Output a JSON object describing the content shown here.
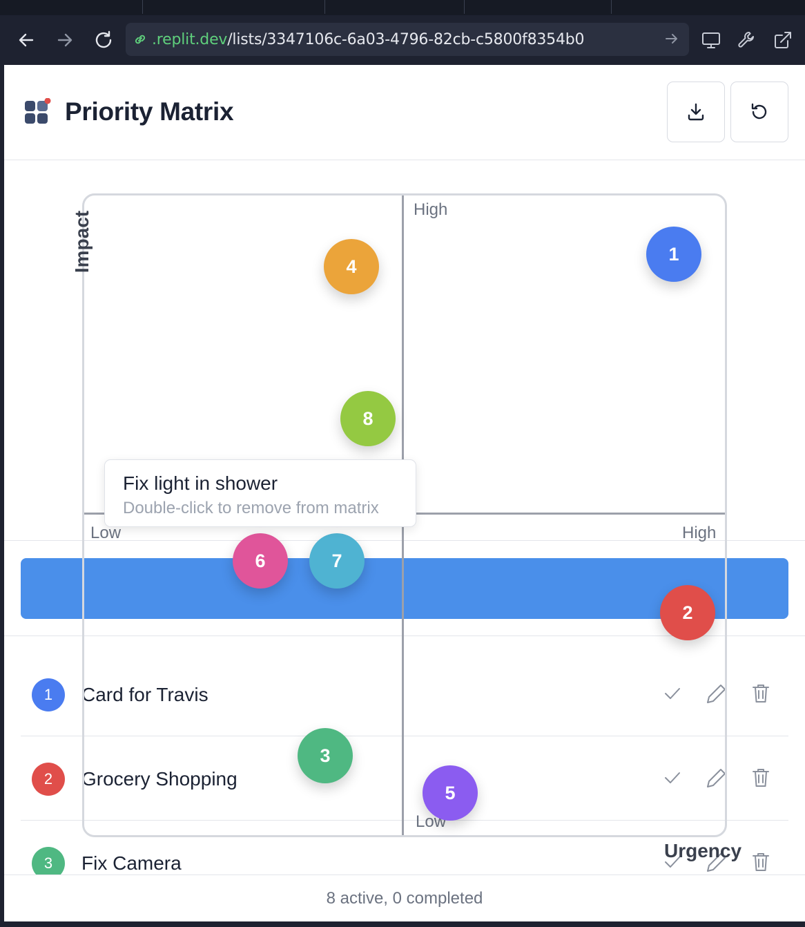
{
  "browser": {
    "url_host": ".replit.dev",
    "url_path": "/lists/3347106c-6a03-4796-82cb-c5800f8354b0"
  },
  "app": {
    "title": "Priority Matrix"
  },
  "matrix": {
    "axis_y": "Impact",
    "axis_x": "Urgency",
    "labels": {
      "top_high": "High",
      "left_low": "Low",
      "right_high": "High",
      "bottom_low": "Low"
    },
    "bubbles": [
      {
        "number": "1",
        "color": "#4a7cf0"
      },
      {
        "number": "2",
        "color": "#e04e4a"
      },
      {
        "number": "3",
        "color": "#4fb882"
      },
      {
        "number": "4",
        "color": "#eba43a"
      },
      {
        "number": "5",
        "color": "#8b5cf0"
      },
      {
        "number": "6",
        "color": "#e0559a"
      },
      {
        "number": "7",
        "color": "#4fb3d2"
      },
      {
        "number": "8",
        "color": "#94c942"
      }
    ],
    "tooltip": {
      "title": "Fix light in shower",
      "hint": "Double-click to remove from matrix"
    }
  },
  "tasks": [
    {
      "number": "1",
      "label": "Card for Travis",
      "color": "#4a7cf0"
    },
    {
      "number": "2",
      "label": "Grocery Shopping",
      "color": "#e04e4a"
    },
    {
      "number": "3",
      "label": "Fix Camera",
      "color": "#4fb882"
    }
  ],
  "footer": {
    "status": "8 active, 0 completed"
  }
}
